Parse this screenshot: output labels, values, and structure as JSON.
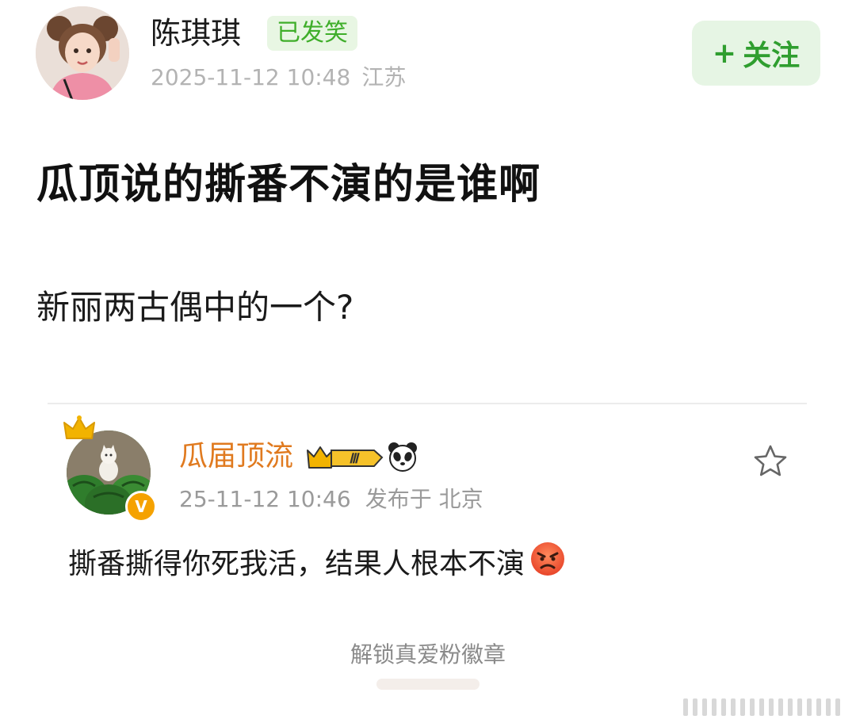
{
  "post": {
    "author": {
      "name": "陈琪琪",
      "badge": "已发笑",
      "avatar_icon": "user-avatar-photo"
    },
    "timestamp": "2025-11-12 10:48",
    "location": "江苏",
    "follow_button": {
      "icon": "plus-icon",
      "label": "关注"
    },
    "title": "瓜顶说的撕番不演的是谁啊",
    "body": "新丽两古偶中的一个?"
  },
  "quoted": {
    "author": {
      "name": "瓜届顶流",
      "avatar_icon": "watermelon-cat-avatar",
      "crown_icon": "crown-icon",
      "verify_icon": "verified-v-icon",
      "level_badge": "Ⅲ",
      "level_icon": "fan-level-badge-icon",
      "panda_icon": "panda-icon",
      "verify_letter": "V"
    },
    "timestamp": "25-11-12 10:46",
    "published_from": "发布于 北京",
    "text": "撕番撕得你死我活，结果人根本不演",
    "emoji": "angry-face-icon",
    "favorite_icon": "star-outline-icon"
  },
  "footer": {
    "unlock_label": "解锁真爱粉徽章",
    "watermark_icon": "weibo-watermark-icon"
  },
  "colors": {
    "follow_bg": "#e6f5e4",
    "follow_text": "#2f9e2f",
    "badge_bg": "#e8f6e3",
    "badge_text": "#3fae2a",
    "quoted_name": "#e07a1f",
    "meta_gray": "#b3b3b3"
  }
}
